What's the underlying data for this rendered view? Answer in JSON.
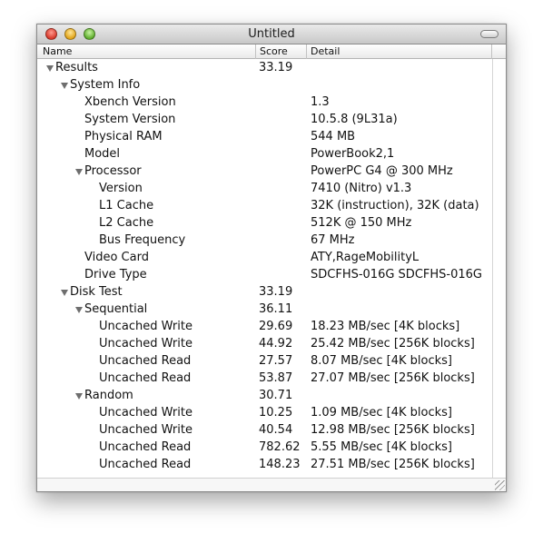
{
  "window": {
    "title": "Untitled"
  },
  "columns": {
    "name": "Name",
    "score": "Score",
    "detail": "Detail"
  },
  "rows": [
    {
      "name": "Results",
      "score": "33.19",
      "detail": "",
      "level": 0,
      "expander": true
    },
    {
      "name": "System Info",
      "score": "",
      "detail": "",
      "level": 1,
      "expander": true
    },
    {
      "name": "Xbench Version",
      "score": "",
      "detail": "1.3",
      "level": 2,
      "expander": false
    },
    {
      "name": "System Version",
      "score": "",
      "detail": "10.5.8 (9L31a)",
      "level": 2,
      "expander": false
    },
    {
      "name": "Physical RAM",
      "score": "",
      "detail": "544 MB",
      "level": 2,
      "expander": false
    },
    {
      "name": "Model",
      "score": "",
      "detail": "PowerBook2,1",
      "level": 2,
      "expander": false
    },
    {
      "name": "Processor",
      "score": "",
      "detail": "PowerPC G4 @ 300 MHz",
      "level": 2,
      "expander": true
    },
    {
      "name": "Version",
      "score": "",
      "detail": "7410 (Nitro) v1.3",
      "level": 3,
      "expander": false
    },
    {
      "name": "L1 Cache",
      "score": "",
      "detail": "32K (instruction), 32K (data)",
      "level": 3,
      "expander": false
    },
    {
      "name": "L2 Cache",
      "score": "",
      "detail": "512K @ 150 MHz",
      "level": 3,
      "expander": false
    },
    {
      "name": "Bus Frequency",
      "score": "",
      "detail": "67 MHz",
      "level": 3,
      "expander": false
    },
    {
      "name": "Video Card",
      "score": "",
      "detail": "ATY,RageMobilityL",
      "level": 2,
      "expander": false
    },
    {
      "name": "Drive Type",
      "score": "",
      "detail": "SDCFHS-016G SDCFHS-016G",
      "level": 2,
      "expander": false
    },
    {
      "name": "Disk Test",
      "score": "33.19",
      "detail": "",
      "level": 1,
      "expander": true
    },
    {
      "name": "Sequential",
      "score": "36.11",
      "detail": "",
      "level": 2,
      "expander": true
    },
    {
      "name": "Uncached Write",
      "score": "29.69",
      "detail": "18.23 MB/sec [4K blocks]",
      "level": 3,
      "expander": false
    },
    {
      "name": "Uncached Write",
      "score": "44.92",
      "detail": "25.42 MB/sec [256K blocks]",
      "level": 3,
      "expander": false
    },
    {
      "name": "Uncached Read",
      "score": "27.57",
      "detail": "8.07 MB/sec [4K blocks]",
      "level": 3,
      "expander": false
    },
    {
      "name": "Uncached Read",
      "score": "53.87",
      "detail": "27.07 MB/sec [256K blocks]",
      "level": 3,
      "expander": false
    },
    {
      "name": "Random",
      "score": "30.71",
      "detail": "",
      "level": 2,
      "expander": true
    },
    {
      "name": "Uncached Write",
      "score": "10.25",
      "detail": "1.09 MB/sec [4K blocks]",
      "level": 3,
      "expander": false
    },
    {
      "name": "Uncached Write",
      "score": "40.54",
      "detail": "12.98 MB/sec [256K blocks]",
      "level": 3,
      "expander": false
    },
    {
      "name": "Uncached Read",
      "score": "782.62",
      "detail": "5.55 MB/sec [4K blocks]",
      "level": 3,
      "expander": false
    },
    {
      "name": "Uncached Read",
      "score": "148.23",
      "detail": "27.51 MB/sec [256K blocks]",
      "level": 3,
      "expander": false
    }
  ],
  "icons": {
    "close": "close-button-icon",
    "minimize": "minimize-button-icon",
    "zoom": "zoom-button-icon",
    "expander": "disclosure-triangle-icon",
    "resize": "resize-grip-icon"
  },
  "colors": {
    "close": "#d83a2c",
    "minimize": "#e2a51a",
    "zoom": "#5fae2d"
  }
}
